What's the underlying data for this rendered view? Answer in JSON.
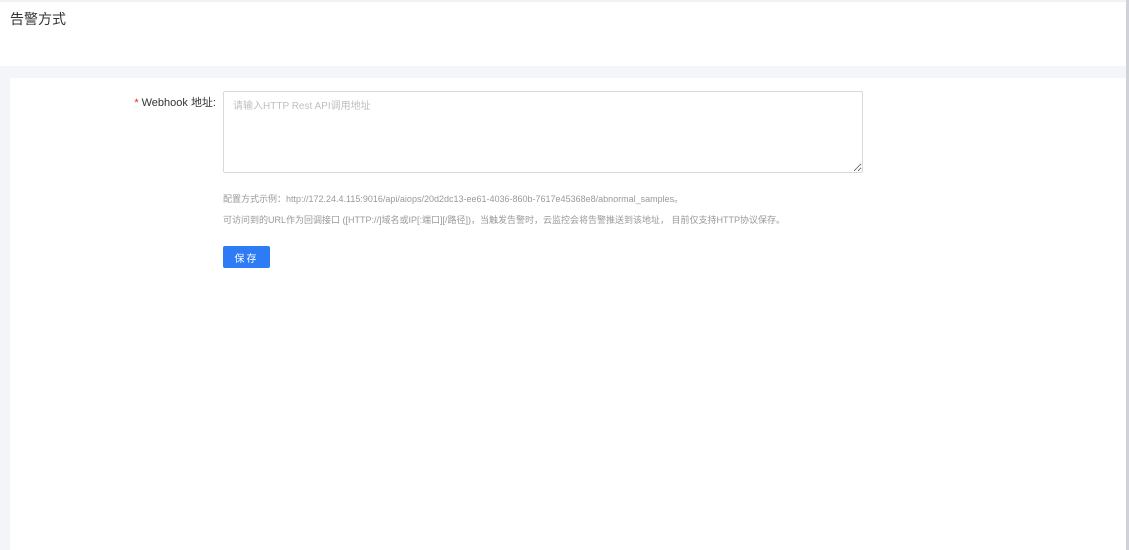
{
  "header": {
    "title": "告警方式"
  },
  "form": {
    "webhook": {
      "required_mark": "*",
      "label": "Webhook 地址:",
      "value": "",
      "placeholder": "请输入HTTP Rest API调用地址"
    },
    "hints": [
      "配置方式示例：http://172.24.4.115:9016/api/aiops/20d2dc13-ee61-4036-860b-7617e45368e8/abnormal_samples。",
      "可访问到的URL作为回调接口 ([HTTP://]域名或IP[:端口][/路径])，当触发告警时，云监控会将告警推送到该地址， 目前仅支持HTTP协议保存。"
    ],
    "save_label": "保存"
  },
  "colors": {
    "primary": "#2d7cf6",
    "required": "#f5222d",
    "hint_text": "#999999",
    "page_bg": "#f3f5f8"
  }
}
